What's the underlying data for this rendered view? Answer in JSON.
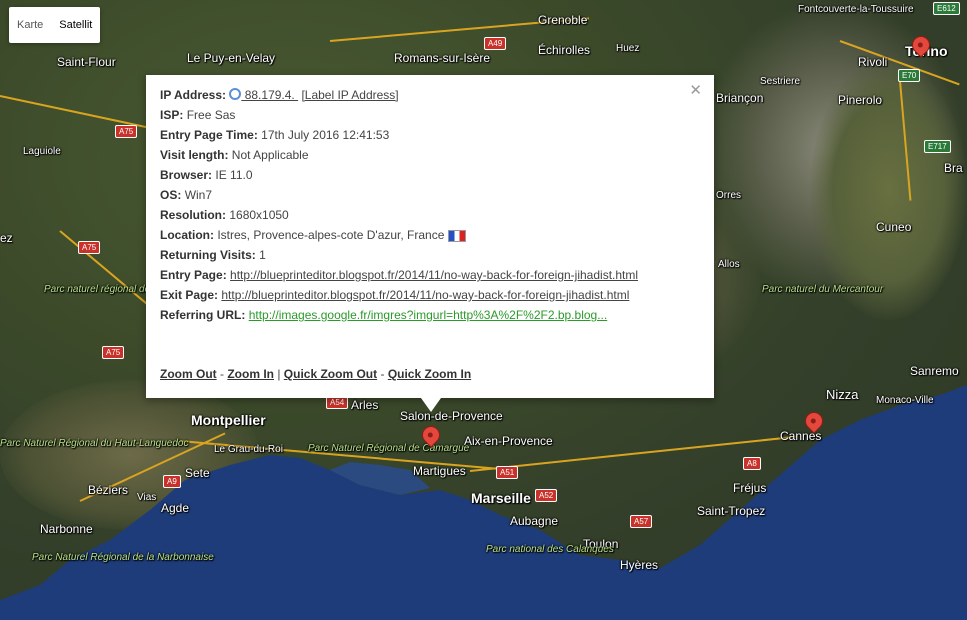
{
  "map_type": {
    "options": [
      "Karte",
      "Satellit"
    ],
    "selected": "Satellit"
  },
  "places": {
    "grenoble": "Grenoble",
    "echirolles": "Échirolles",
    "huez": "Huez",
    "fontcouverte": "Fontcouverte-la-Toussuire",
    "le_puy": "Le Puy-en-Velay",
    "romans": "Romans-sur-Isère",
    "saint_flour": "Saint-Flour",
    "laguiole": "Laguiole",
    "rivoli": "Rivoli",
    "torino": "Torino",
    "sestriere": "Sestriere",
    "briancon": "Briançon",
    "pinerolo": "Pinerolo",
    "bra": "Bra",
    "cuneo": "Cuneo",
    "orres": "Orres",
    "allos": "Allos",
    "mercantour": "Parc naturel du Mercantour",
    "sanremo": "Sanremo",
    "nizza": "Nizza",
    "monaco": "Monaco-Ville",
    "cannes": "Cannes",
    "frejus": "Fréjus",
    "saint_tropez": "Saint-Tropez",
    "montpellier": "Montpellier",
    "arles": "Arles",
    "salon": "Salon-de-Provence",
    "aix": "Aix-en-Provence",
    "martigues": "Martigues",
    "marseille": "Marseille",
    "aubagne": "Aubagne",
    "toulon": "Toulon",
    "hyeres": "Hyères",
    "calanques": "Parc national des Calanques",
    "camargue": "Parc Naturel Régional de Camargue",
    "grau": "Le Grau-du-Roi",
    "sete": "Sete",
    "beziers": "Béziers",
    "vias": "Vias",
    "agde": "Agde",
    "narbonne": "Narbonne",
    "narbonnaise": "Parc Naturel Régional de la Narbonnaise",
    "grands_causses": "Parc naturel régional des Grands Causses",
    "haut_languedoc": "Parc Naturel Régional du Haut-Languedoc",
    "ez": "ez"
  },
  "roads": [
    "A49",
    "A75",
    "A75",
    "A75",
    "E612",
    "E70",
    "E717",
    "A54",
    "A9",
    "A51",
    "A52",
    "A57",
    "A8"
  ],
  "popup": {
    "ip_label": "IP Address:",
    "ip_value": " 88.179.4.        ",
    "label_ip": "[Label IP Address]",
    "isp_label": "ISP:",
    "isp_value": "Free Sas",
    "entry_time_label": "Entry Page Time:",
    "entry_time_value": "17th July 2016 12:41:53",
    "visit_length_label": "Visit length:",
    "visit_length_value": "Not Applicable",
    "browser_label": "Browser:",
    "browser_value": "IE 11.0",
    "os_label": "OS:",
    "os_value": "Win7",
    "resolution_label": "Resolution:",
    "resolution_value": "1680x1050",
    "location_label": "Location:",
    "location_value": "Istres, Provence-alpes-cote D'azur, France",
    "returning_label": "Returning Visits:",
    "returning_value": "1",
    "entry_page_label": "Entry Page:",
    "entry_page_value": "http://blueprinteditor.blogspot.fr/2014/11/no-way-back-for-foreign-jihadist.html",
    "exit_page_label": "Exit Page:",
    "exit_page_value": "http://blueprinteditor.blogspot.fr/2014/11/no-way-back-for-foreign-jihadist.html",
    "referring_label": "Referring URL:",
    "referring_value": "http://images.google.fr/imgres?imgurl=http%3A%2F%2F2.bp.blog...",
    "zoom_out": "Zoom Out",
    "zoom_in": "Zoom In",
    "quick_zoom_out": "Quick Zoom Out",
    "quick_zoom_in": "Quick Zoom In",
    "sep1": " - ",
    "sep2": " | ",
    "sep3": " - "
  },
  "colors": {
    "sea": "#1e3a78",
    "land": "#3c4a2a",
    "road": "#d9a520",
    "pin": "#e4473b",
    "link_green": "#2a9a2a"
  }
}
